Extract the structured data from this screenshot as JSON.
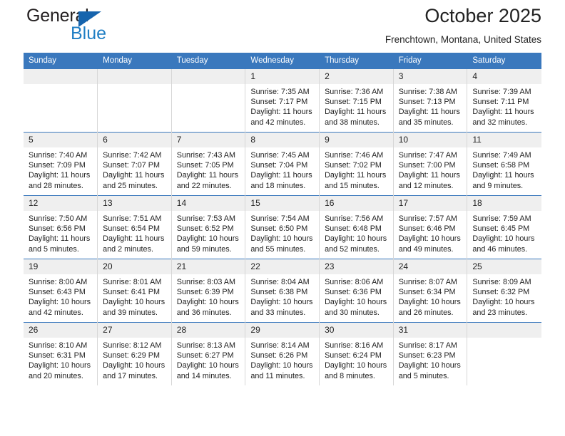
{
  "logo": {
    "word_one": "General",
    "word_two": "Blue",
    "triangle_color": "#1664ad",
    "blue_color": "#1f7ec4"
  },
  "header": {
    "title": "October 2025",
    "subtitle": "Frenchtown, Montana, United States",
    "header_bg": "#3a78bd",
    "header_text": "#ffffff",
    "daynum_bg": "#efefef"
  },
  "weekday_headers": [
    "Sunday",
    "Monday",
    "Tuesday",
    "Wednesday",
    "Thursday",
    "Friday",
    "Saturday"
  ],
  "weeks": [
    [
      {
        "day": "",
        "empty": true,
        "sunrise": "",
        "sunset": "",
        "daylight_1": "",
        "daylight_2": ""
      },
      {
        "day": "",
        "empty": true,
        "sunrise": "",
        "sunset": "",
        "daylight_1": "",
        "daylight_2": ""
      },
      {
        "day": "",
        "empty": true,
        "sunrise": "",
        "sunset": "",
        "daylight_1": "",
        "daylight_2": ""
      },
      {
        "day": "1",
        "empty": false,
        "sunrise": "Sunrise: 7:35 AM",
        "sunset": "Sunset: 7:17 PM",
        "daylight_1": "Daylight: 11 hours",
        "daylight_2": "and 42 minutes."
      },
      {
        "day": "2",
        "empty": false,
        "sunrise": "Sunrise: 7:36 AM",
        "sunset": "Sunset: 7:15 PM",
        "daylight_1": "Daylight: 11 hours",
        "daylight_2": "and 38 minutes."
      },
      {
        "day": "3",
        "empty": false,
        "sunrise": "Sunrise: 7:38 AM",
        "sunset": "Sunset: 7:13 PM",
        "daylight_1": "Daylight: 11 hours",
        "daylight_2": "and 35 minutes."
      },
      {
        "day": "4",
        "empty": false,
        "sunrise": "Sunrise: 7:39 AM",
        "sunset": "Sunset: 7:11 PM",
        "daylight_1": "Daylight: 11 hours",
        "daylight_2": "and 32 minutes."
      }
    ],
    [
      {
        "day": "5",
        "empty": false,
        "sunrise": "Sunrise: 7:40 AM",
        "sunset": "Sunset: 7:09 PM",
        "daylight_1": "Daylight: 11 hours",
        "daylight_2": "and 28 minutes."
      },
      {
        "day": "6",
        "empty": false,
        "sunrise": "Sunrise: 7:42 AM",
        "sunset": "Sunset: 7:07 PM",
        "daylight_1": "Daylight: 11 hours",
        "daylight_2": "and 25 minutes."
      },
      {
        "day": "7",
        "empty": false,
        "sunrise": "Sunrise: 7:43 AM",
        "sunset": "Sunset: 7:05 PM",
        "daylight_1": "Daylight: 11 hours",
        "daylight_2": "and 22 minutes."
      },
      {
        "day": "8",
        "empty": false,
        "sunrise": "Sunrise: 7:45 AM",
        "sunset": "Sunset: 7:04 PM",
        "daylight_1": "Daylight: 11 hours",
        "daylight_2": "and 18 minutes."
      },
      {
        "day": "9",
        "empty": false,
        "sunrise": "Sunrise: 7:46 AM",
        "sunset": "Sunset: 7:02 PM",
        "daylight_1": "Daylight: 11 hours",
        "daylight_2": "and 15 minutes."
      },
      {
        "day": "10",
        "empty": false,
        "sunrise": "Sunrise: 7:47 AM",
        "sunset": "Sunset: 7:00 PM",
        "daylight_1": "Daylight: 11 hours",
        "daylight_2": "and 12 minutes."
      },
      {
        "day": "11",
        "empty": false,
        "sunrise": "Sunrise: 7:49 AM",
        "sunset": "Sunset: 6:58 PM",
        "daylight_1": "Daylight: 11 hours",
        "daylight_2": "and 9 minutes."
      }
    ],
    [
      {
        "day": "12",
        "empty": false,
        "sunrise": "Sunrise: 7:50 AM",
        "sunset": "Sunset: 6:56 PM",
        "daylight_1": "Daylight: 11 hours",
        "daylight_2": "and 5 minutes."
      },
      {
        "day": "13",
        "empty": false,
        "sunrise": "Sunrise: 7:51 AM",
        "sunset": "Sunset: 6:54 PM",
        "daylight_1": "Daylight: 11 hours",
        "daylight_2": "and 2 minutes."
      },
      {
        "day": "14",
        "empty": false,
        "sunrise": "Sunrise: 7:53 AM",
        "sunset": "Sunset: 6:52 PM",
        "daylight_1": "Daylight: 10 hours",
        "daylight_2": "and 59 minutes."
      },
      {
        "day": "15",
        "empty": false,
        "sunrise": "Sunrise: 7:54 AM",
        "sunset": "Sunset: 6:50 PM",
        "daylight_1": "Daylight: 10 hours",
        "daylight_2": "and 55 minutes."
      },
      {
        "day": "16",
        "empty": false,
        "sunrise": "Sunrise: 7:56 AM",
        "sunset": "Sunset: 6:48 PM",
        "daylight_1": "Daylight: 10 hours",
        "daylight_2": "and 52 minutes."
      },
      {
        "day": "17",
        "empty": false,
        "sunrise": "Sunrise: 7:57 AM",
        "sunset": "Sunset: 6:46 PM",
        "daylight_1": "Daylight: 10 hours",
        "daylight_2": "and 49 minutes."
      },
      {
        "day": "18",
        "empty": false,
        "sunrise": "Sunrise: 7:59 AM",
        "sunset": "Sunset: 6:45 PM",
        "daylight_1": "Daylight: 10 hours",
        "daylight_2": "and 46 minutes."
      }
    ],
    [
      {
        "day": "19",
        "empty": false,
        "sunrise": "Sunrise: 8:00 AM",
        "sunset": "Sunset: 6:43 PM",
        "daylight_1": "Daylight: 10 hours",
        "daylight_2": "and 42 minutes."
      },
      {
        "day": "20",
        "empty": false,
        "sunrise": "Sunrise: 8:01 AM",
        "sunset": "Sunset: 6:41 PM",
        "daylight_1": "Daylight: 10 hours",
        "daylight_2": "and 39 minutes."
      },
      {
        "day": "21",
        "empty": false,
        "sunrise": "Sunrise: 8:03 AM",
        "sunset": "Sunset: 6:39 PM",
        "daylight_1": "Daylight: 10 hours",
        "daylight_2": "and 36 minutes."
      },
      {
        "day": "22",
        "empty": false,
        "sunrise": "Sunrise: 8:04 AM",
        "sunset": "Sunset: 6:38 PM",
        "daylight_1": "Daylight: 10 hours",
        "daylight_2": "and 33 minutes."
      },
      {
        "day": "23",
        "empty": false,
        "sunrise": "Sunrise: 8:06 AM",
        "sunset": "Sunset: 6:36 PM",
        "daylight_1": "Daylight: 10 hours",
        "daylight_2": "and 30 minutes."
      },
      {
        "day": "24",
        "empty": false,
        "sunrise": "Sunrise: 8:07 AM",
        "sunset": "Sunset: 6:34 PM",
        "daylight_1": "Daylight: 10 hours",
        "daylight_2": "and 26 minutes."
      },
      {
        "day": "25",
        "empty": false,
        "sunrise": "Sunrise: 8:09 AM",
        "sunset": "Sunset: 6:32 PM",
        "daylight_1": "Daylight: 10 hours",
        "daylight_2": "and 23 minutes."
      }
    ],
    [
      {
        "day": "26",
        "empty": false,
        "sunrise": "Sunrise: 8:10 AM",
        "sunset": "Sunset: 6:31 PM",
        "daylight_1": "Daylight: 10 hours",
        "daylight_2": "and 20 minutes."
      },
      {
        "day": "27",
        "empty": false,
        "sunrise": "Sunrise: 8:12 AM",
        "sunset": "Sunset: 6:29 PM",
        "daylight_1": "Daylight: 10 hours",
        "daylight_2": "and 17 minutes."
      },
      {
        "day": "28",
        "empty": false,
        "sunrise": "Sunrise: 8:13 AM",
        "sunset": "Sunset: 6:27 PM",
        "daylight_1": "Daylight: 10 hours",
        "daylight_2": "and 14 minutes."
      },
      {
        "day": "29",
        "empty": false,
        "sunrise": "Sunrise: 8:14 AM",
        "sunset": "Sunset: 6:26 PM",
        "daylight_1": "Daylight: 10 hours",
        "daylight_2": "and 11 minutes."
      },
      {
        "day": "30",
        "empty": false,
        "sunrise": "Sunrise: 8:16 AM",
        "sunset": "Sunset: 6:24 PM",
        "daylight_1": "Daylight: 10 hours",
        "daylight_2": "and 8 minutes."
      },
      {
        "day": "31",
        "empty": false,
        "sunrise": "Sunrise: 8:17 AM",
        "sunset": "Sunset: 6:23 PM",
        "daylight_1": "Daylight: 10 hours",
        "daylight_2": "and 5 minutes."
      },
      {
        "day": "",
        "empty": true,
        "sunrise": "",
        "sunset": "",
        "daylight_1": "",
        "daylight_2": ""
      }
    ]
  ]
}
